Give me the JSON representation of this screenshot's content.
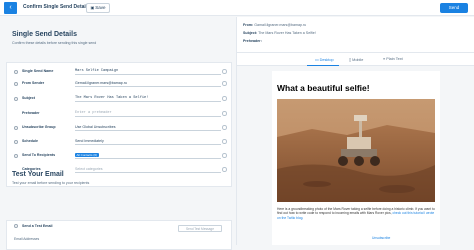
{
  "header": {
    "back_icon": "chevron-left-icon",
    "title": "Confirm Single Send Details",
    "save_label": "Save",
    "send_label": "Send"
  },
  "details": {
    "title": "Single Send Details",
    "subtitle": "Confirm these details before sending this single send",
    "fields": [
      {
        "label": "Single Send Name",
        "value": "Mars Selfie Campaign",
        "mono": true
      },
      {
        "label": "From Sender",
        "value": "Gemail.ilgraner.mars@bamap.ru",
        "mono": false
      },
      {
        "label": "Subject",
        "value": "The Mars Rover Has Taken a Selfie!",
        "mono": true
      },
      {
        "label": "Preheader",
        "value": "Enter a preheader",
        "mono": true,
        "placeholder": true
      },
      {
        "label": "Unsubscribe Group",
        "value": "Use Global Unsubscribes",
        "mono": false
      },
      {
        "label": "Schedule",
        "value": "Send Immediately",
        "mono": false
      },
      {
        "label": "Send To Recipients",
        "value": "All Contacts (0)",
        "mono": false,
        "tag": true
      },
      {
        "label": "Categories",
        "value": "Select categories",
        "mono": false,
        "placeholder": true
      }
    ]
  },
  "test": {
    "title": "Test Your Email",
    "subtitle": "Test your email before sending to your recipients",
    "send_test_label": "Send a Test Email",
    "send_test_button": "Send Test Message",
    "email_addresses_label": "Email Addresses"
  },
  "preview": {
    "from_label": "From:",
    "from_value": "Gamail.ilgraner.mars@bamap.ru",
    "subject_label": "Subject:",
    "subject_value": "The Mars Rover Has Taken a Selfie!",
    "preheader_label": "Preheader:",
    "tabs": [
      "Desktop",
      "Mobile",
      "Plain Text"
    ],
    "email_title": "What a beautiful selfie!",
    "body": "Here is a groundbreaking photo of the Mars Rover taking a selfie before doing a historic climb. If you want to find out how to write code to respond to incoming emails with Mars Rover pics,",
    "body_link": "check out this tutorial I wrote on the Twilio blog.",
    "edit_link": "Unsubscribe"
  }
}
